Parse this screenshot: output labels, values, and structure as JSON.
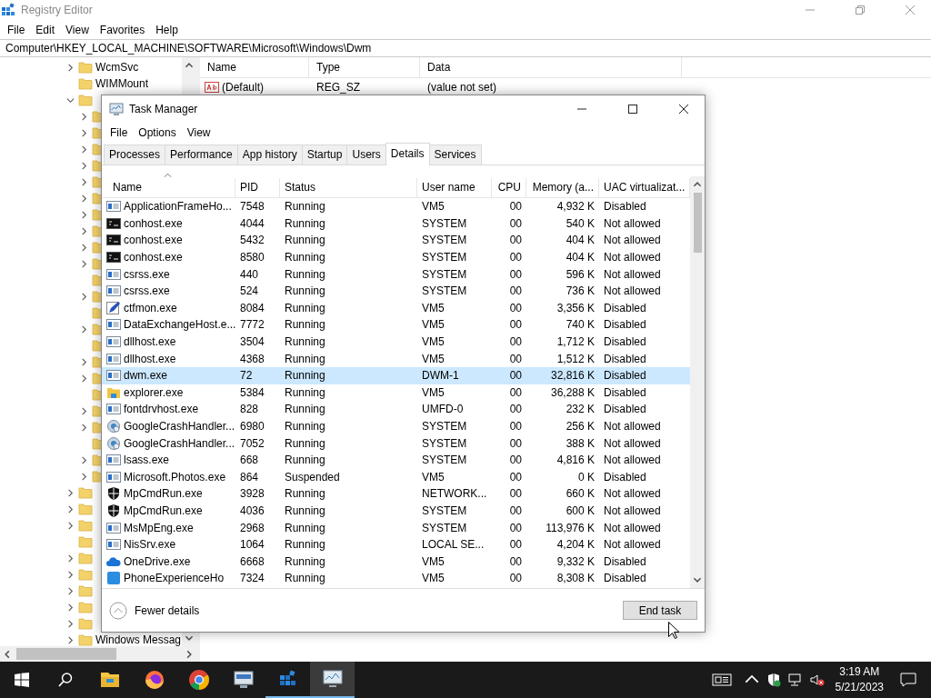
{
  "registry_editor": {
    "title": "Registry Editor",
    "menu": [
      "File",
      "Edit",
      "View",
      "Favorites",
      "Help"
    ],
    "address": "Computer\\HKEY_LOCAL_MACHINE\\SOFTWARE\\Microsoft\\Windows\\Dwm",
    "tree": [
      {
        "label": "WcmSvc",
        "expandable": true,
        "expanded": false
      },
      {
        "label": "WIMMount",
        "expandable": false
      },
      {
        "expandable": true,
        "expanded": true,
        "children": [
          {
            "expandable": true
          },
          {
            "expandable": true
          },
          {
            "expandable": true
          },
          {
            "expandable": true
          },
          {
            "expandable": true
          },
          {
            "expandable": true
          },
          {
            "expandable": true
          },
          {
            "expandable": true
          },
          {
            "expandable": true
          },
          {
            "expandable": true
          },
          {
            "expandable": false
          },
          {
            "expandable": true
          },
          {
            "expandable": false
          },
          {
            "expandable": true
          },
          {
            "expandable": false
          },
          {
            "expandable": true
          },
          {
            "expandable": true
          },
          {
            "expandable": false
          },
          {
            "expandable": true
          },
          {
            "expandable": true
          },
          {
            "expandable": false
          },
          {
            "expandable": true
          },
          {
            "expandable": true
          }
        ]
      },
      {
        "expandable": true,
        "expanded": false
      },
      {
        "expandable": true,
        "expanded": false
      },
      {
        "expandable": true,
        "expanded": false
      },
      {
        "expandable": false
      },
      {
        "expandable": true,
        "expanded": false
      },
      {
        "expandable": true,
        "expanded": false
      },
      {
        "expandable": true,
        "expanded": false
      },
      {
        "expandable": true,
        "expanded": false
      },
      {
        "expandable": true,
        "expanded": false
      },
      {
        "label": "Windows Messag",
        "expandable": true,
        "expanded": false
      }
    ],
    "list": {
      "columns": [
        "Name",
        "Type",
        "Data"
      ],
      "rows": [
        {
          "name": "(Default)",
          "type": "REG_SZ",
          "data": "(value not set)"
        }
      ]
    }
  },
  "task_manager": {
    "title": "Task Manager",
    "menu": [
      "File",
      "Options",
      "View"
    ],
    "tabs": [
      {
        "label": "Processes",
        "selected": false
      },
      {
        "label": "Performance",
        "selected": false
      },
      {
        "label": "App history",
        "selected": false
      },
      {
        "label": "Startup",
        "selected": false
      },
      {
        "label": "Users",
        "selected": false
      },
      {
        "label": "Details",
        "selected": true
      },
      {
        "label": "Services",
        "selected": false
      }
    ],
    "columns": [
      "Name",
      "PID",
      "Status",
      "User name",
      "CPU",
      "Memory (a...",
      "UAC virtualizat..."
    ],
    "rows": [
      {
        "kind": "app",
        "name": "ApplicationFrameHo...",
        "pid": "7548",
        "status": "Running",
        "user": "VM5",
        "cpu": "00",
        "memory": "4,932 K",
        "uac": "Disabled",
        "selected": false
      },
      {
        "kind": "console",
        "name": "conhost.exe",
        "pid": "4044",
        "status": "Running",
        "user": "SYSTEM",
        "cpu": "00",
        "memory": "540 K",
        "uac": "Not allowed",
        "selected": false
      },
      {
        "kind": "console",
        "name": "conhost.exe",
        "pid": "5432",
        "status": "Running",
        "user": "SYSTEM",
        "cpu": "00",
        "memory": "404 K",
        "uac": "Not allowed",
        "selected": false
      },
      {
        "kind": "console",
        "name": "conhost.exe",
        "pid": "8580",
        "status": "Running",
        "user": "SYSTEM",
        "cpu": "00",
        "memory": "404 K",
        "uac": "Not allowed",
        "selected": false
      },
      {
        "kind": "app",
        "name": "csrss.exe",
        "pid": "440",
        "status": "Running",
        "user": "SYSTEM",
        "cpu": "00",
        "memory": "596 K",
        "uac": "Not allowed",
        "selected": false
      },
      {
        "kind": "app",
        "name": "csrss.exe",
        "pid": "524",
        "status": "Running",
        "user": "SYSTEM",
        "cpu": "00",
        "memory": "736 K",
        "uac": "Not allowed",
        "selected": false
      },
      {
        "kind": "pen",
        "name": "ctfmon.exe",
        "pid": "8084",
        "status": "Running",
        "user": "VM5",
        "cpu": "00",
        "memory": "3,356 K",
        "uac": "Disabled",
        "selected": false
      },
      {
        "kind": "app",
        "name": "DataExchangeHost.e...",
        "pid": "7772",
        "status": "Running",
        "user": "VM5",
        "cpu": "00",
        "memory": "740 K",
        "uac": "Disabled",
        "selected": false
      },
      {
        "kind": "app",
        "name": "dllhost.exe",
        "pid": "3504",
        "status": "Running",
        "user": "VM5",
        "cpu": "00",
        "memory": "1,712 K",
        "uac": "Disabled",
        "selected": false
      },
      {
        "kind": "app",
        "name": "dllhost.exe",
        "pid": "4368",
        "status": "Running",
        "user": "VM5",
        "cpu": "00",
        "memory": "1,512 K",
        "uac": "Disabled",
        "selected": false
      },
      {
        "kind": "app",
        "name": "dwm.exe",
        "pid": "72",
        "status": "Running",
        "user": "DWM-1",
        "cpu": "00",
        "memory": "32,816 K",
        "uac": "Disabled",
        "selected": true
      },
      {
        "kind": "folder",
        "name": "explorer.exe",
        "pid": "5384",
        "status": "Running",
        "user": "VM5",
        "cpu": "00",
        "memory": "36,288 K",
        "uac": "Disabled",
        "selected": false
      },
      {
        "kind": "app",
        "name": "fontdrvhost.exe",
        "pid": "828",
        "status": "Running",
        "user": "UMFD-0",
        "cpu": "00",
        "memory": "232 K",
        "uac": "Disabled",
        "selected": false
      },
      {
        "kind": "crash",
        "name": "GoogleCrashHandler...",
        "pid": "6980",
        "status": "Running",
        "user": "SYSTEM",
        "cpu": "00",
        "memory": "256 K",
        "uac": "Not allowed",
        "selected": false
      },
      {
        "kind": "crash",
        "name": "GoogleCrashHandler...",
        "pid": "7052",
        "status": "Running",
        "user": "SYSTEM",
        "cpu": "00",
        "memory": "388 K",
        "uac": "Not allowed",
        "selected": false
      },
      {
        "kind": "app",
        "name": "lsass.exe",
        "pid": "668",
        "status": "Running",
        "user": "SYSTEM",
        "cpu": "00",
        "memory": "4,816 K",
        "uac": "Not allowed",
        "selected": false
      },
      {
        "kind": "app",
        "name": "Microsoft.Photos.exe",
        "pid": "864",
        "status": "Suspended",
        "user": "VM5",
        "cpu": "00",
        "memory": "0 K",
        "uac": "Disabled",
        "selected": false
      },
      {
        "kind": "shield",
        "name": "MpCmdRun.exe",
        "pid": "3928",
        "status": "Running",
        "user": "NETWORK...",
        "cpu": "00",
        "memory": "660 K",
        "uac": "Not allowed",
        "selected": false
      },
      {
        "kind": "shield",
        "name": "MpCmdRun.exe",
        "pid": "4036",
        "status": "Running",
        "user": "SYSTEM",
        "cpu": "00",
        "memory": "600 K",
        "uac": "Not allowed",
        "selected": false
      },
      {
        "kind": "app",
        "name": "MsMpEng.exe",
        "pid": "2968",
        "status": "Running",
        "user": "SYSTEM",
        "cpu": "00",
        "memory": "113,976 K",
        "uac": "Not allowed",
        "selected": false
      },
      {
        "kind": "app",
        "name": "NisSrv.exe",
        "pid": "1064",
        "status": "Running",
        "user": "LOCAL SE...",
        "cpu": "00",
        "memory": "4,204 K",
        "uac": "Not allowed",
        "selected": false
      },
      {
        "kind": "cloud",
        "name": "OneDrive.exe",
        "pid": "6668",
        "status": "Running",
        "user": "VM5",
        "cpu": "00",
        "memory": "9,332 K",
        "uac": "Disabled",
        "selected": false
      },
      {
        "kind": "phone",
        "name": "PhoneExperienceHo",
        "pid": "7324",
        "status": "Running",
        "user": "VM5",
        "cpu": "00",
        "memory": "8,308 K",
        "uac": "Disabled",
        "selected": false
      }
    ],
    "fewer_details": "Fewer details",
    "end_task": "End task"
  },
  "taskbar": {
    "apps": [
      {
        "kind": "folder",
        "running": false,
        "selected": false
      },
      {
        "kind": "firefox",
        "running": false,
        "selected": false
      },
      {
        "kind": "chrome",
        "running": false,
        "selected": false
      },
      {
        "kind": "remote",
        "running": false,
        "selected": false
      },
      {
        "kind": "registry",
        "running": true,
        "selected": false
      },
      {
        "kind": "monitor",
        "running": true,
        "selected": true
      }
    ],
    "time": "3:19 AM",
    "date": "5/21/2023"
  }
}
